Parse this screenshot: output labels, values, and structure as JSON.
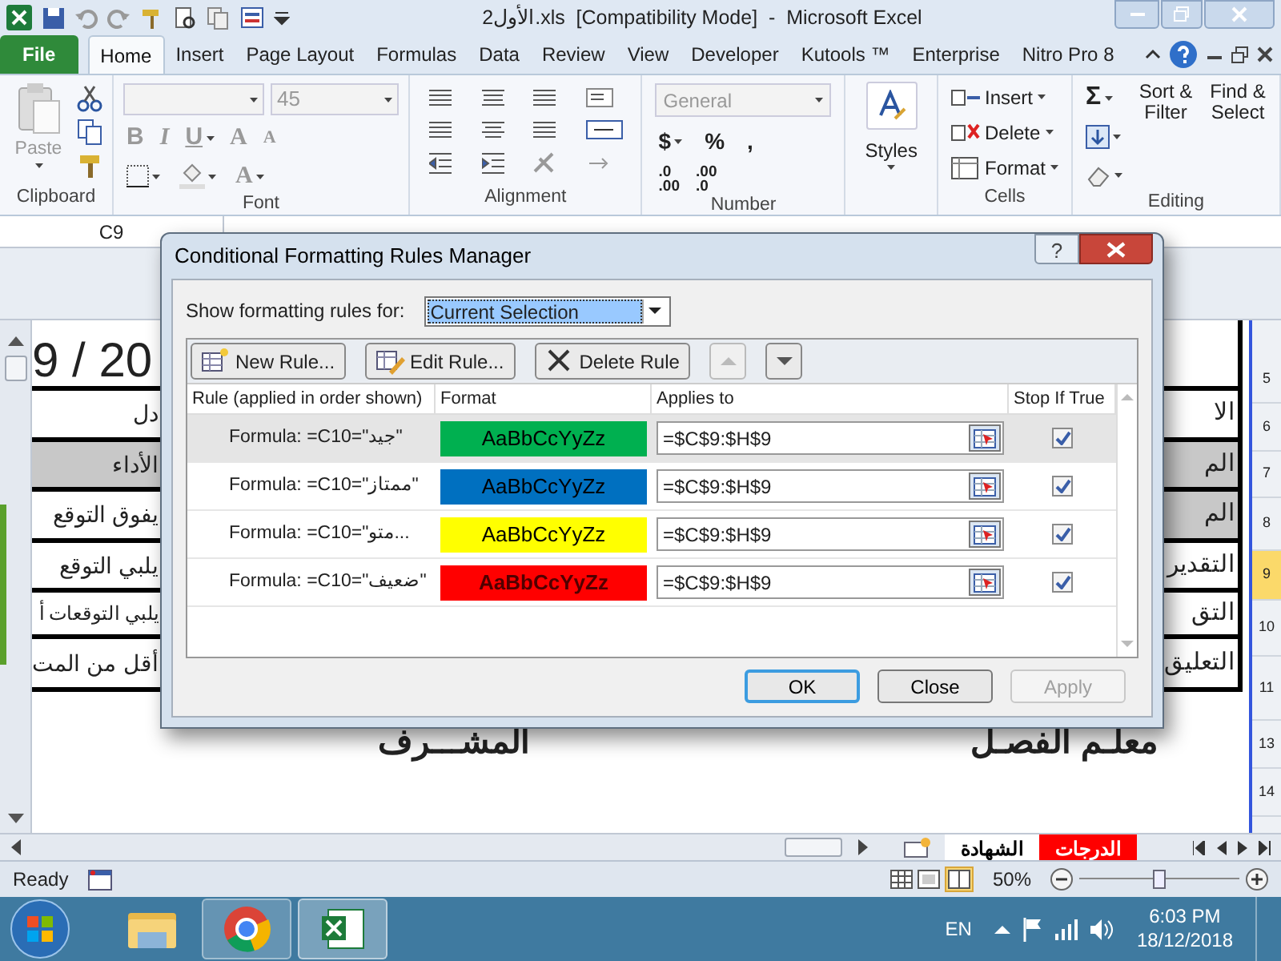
{
  "window": {
    "title": "الأول2.xls  [Compatibility Mode]  -  Microsoft Excel"
  },
  "ribbon_tabs": [
    {
      "label": "File",
      "kind": "file",
      "selected": false
    },
    {
      "label": "Home",
      "kind": "tab",
      "selected": true
    },
    {
      "label": "Insert",
      "kind": "tab",
      "selected": false
    },
    {
      "label": "Page Layout",
      "kind": "tab",
      "selected": false
    },
    {
      "label": "Formulas",
      "kind": "tab",
      "selected": false
    },
    {
      "label": "Data",
      "kind": "tab",
      "selected": false
    },
    {
      "label": "Review",
      "kind": "tab",
      "selected": false
    },
    {
      "label": "View",
      "kind": "tab",
      "selected": false
    },
    {
      "label": "Developer",
      "kind": "tab",
      "selected": false
    },
    {
      "label": "Kutools ™",
      "kind": "tab",
      "selected": false
    },
    {
      "label": "Enterprise",
      "kind": "tab",
      "selected": false
    },
    {
      "label": "Nitro Pro 8",
      "kind": "tab",
      "selected": false
    }
  ],
  "ribbon_groups": [
    {
      "label": "Clipboard",
      "kind": "clipboard",
      "paste": "Paste"
    },
    {
      "label": "Font",
      "kind": "font",
      "size": "45",
      "bold": "B",
      "italic": "I",
      "underline": "U",
      "grow": "A",
      "shrink": "A",
      "font_color": "A"
    },
    {
      "label": "Alignment",
      "kind": "alignment"
    },
    {
      "label": "Number",
      "kind": "number",
      "format": "General",
      "currency": "$",
      "percent": "%",
      "comma": ",",
      "decimals": [
        {
          "top": ".0",
          "bottom": ".00"
        },
        {
          "top": ".00",
          "bottom": ".0"
        }
      ]
    },
    {
      "kind": "styles",
      "button": "Styles"
    },
    {
      "label": "Cells",
      "kind": "cells",
      "buttons": [
        "Insert",
        "Delete",
        "Format"
      ]
    },
    {
      "label": "Editing",
      "kind": "editing",
      "sum": "Σ",
      "sort": "Sort & Filter",
      "find": "Find & Select"
    }
  ],
  "name_box": "C9",
  "sheet": {
    "left_cells": [
      {
        "text": "9 / 20",
        "kind": "big",
        "shaded": false
      },
      {
        "text": "دل",
        "kind": "normal",
        "shaded": false
      },
      {
        "text": "الأداء",
        "kind": "normal",
        "shaded": true
      },
      {
        "text": "يفوق التوقع",
        "kind": "normal",
        "shaded": false
      },
      {
        "text": "يلبي التوقع",
        "kind": "normal",
        "shaded": false
      },
      {
        "text": "يلبي التوقعات أ",
        "kind": "small",
        "shaded": false
      },
      {
        "text": "أقل من المت",
        "kind": "normal",
        "shaded": false
      }
    ],
    "right_cells": [
      {
        "text": "",
        "shaded": false
      },
      {
        "text": "الا",
        "shaded": false
      },
      {
        "text": "الم",
        "shaded": true
      },
      {
        "text": "الم",
        "shaded": true
      },
      {
        "text": "التقدير",
        "shaded": false
      },
      {
        "text": "التق",
        "shaded": false
      },
      {
        "text": "التعليق",
        "shaded": false
      }
    ],
    "row_numbers": [
      {
        "label": "5",
        "selected": false
      },
      {
        "label": "6",
        "selected": false
      },
      {
        "label": "7",
        "selected": false
      },
      {
        "label": "8",
        "selected": false
      },
      {
        "label": "9",
        "selected": true
      },
      {
        "label": "10",
        "selected": false
      },
      {
        "label": "11",
        "selected": false
      },
      {
        "label": "13",
        "selected": false
      },
      {
        "label": "14",
        "selected": false
      }
    ],
    "signatures": [
      "معلـم الفصـل",
      "المشـــرف"
    ]
  },
  "sheet_tabs": [
    {
      "label": "الدرجات",
      "selected": false,
      "color": "#ff0000"
    },
    {
      "label": "الشهادة",
      "selected": true,
      "color": "#ffffff"
    }
  ],
  "status_bar": {
    "text": "Ready",
    "zoom": "50%",
    "zoom_slider": {
      "level": 0.5
    }
  },
  "dialog": {
    "title": "Conditional Formatting Rules Manager",
    "help": "?",
    "show_label": "Show formatting rules for:",
    "scope": "Current Selection",
    "toolbar": [
      "New Rule...",
      "Edit Rule...",
      "Delete Rule"
    ],
    "columns": [
      "Rule (applied in order shown)",
      "Format",
      "Applies to",
      "Stop If True"
    ],
    "rules": [
      {
        "rule": "Formula: =C10=\"جيد\"",
        "preview": "AaBbCcYyZz",
        "color": "#00b050",
        "bold": false,
        "applies_to": "=$C$9:$H$9",
        "stop_if_true": true,
        "selected": true
      },
      {
        "rule": "Formula: =C10=\"ممتاز\"",
        "preview": "AaBbCcYyZz",
        "color": "#0070c0",
        "bold": false,
        "applies_to": "=$C$9:$H$9",
        "stop_if_true": true,
        "selected": false
      },
      {
        "rule": "Formula: =C10=\"متو...",
        "preview": "AaBbCcYyZz",
        "color": "#ffff00",
        "bold": false,
        "applies_to": "=$C$9:$H$9",
        "stop_if_true": true,
        "selected": false
      },
      {
        "rule": "Formula: =C10=\"ضعيف\"",
        "preview": "AaBbCcYyZz",
        "color": "#ff0000",
        "bold": true,
        "applies_to": "=$C$9:$H$9",
        "stop_if_true": true,
        "selected": false
      }
    ],
    "buttons": [
      {
        "label": "OK",
        "default": true,
        "disabled": false
      },
      {
        "label": "Close",
        "default": false,
        "disabled": false
      },
      {
        "label": "Apply",
        "default": false,
        "disabled": true
      }
    ]
  },
  "taskbar": {
    "language": "EN",
    "time": "6:03 PM",
    "date": "18/12/2018"
  }
}
